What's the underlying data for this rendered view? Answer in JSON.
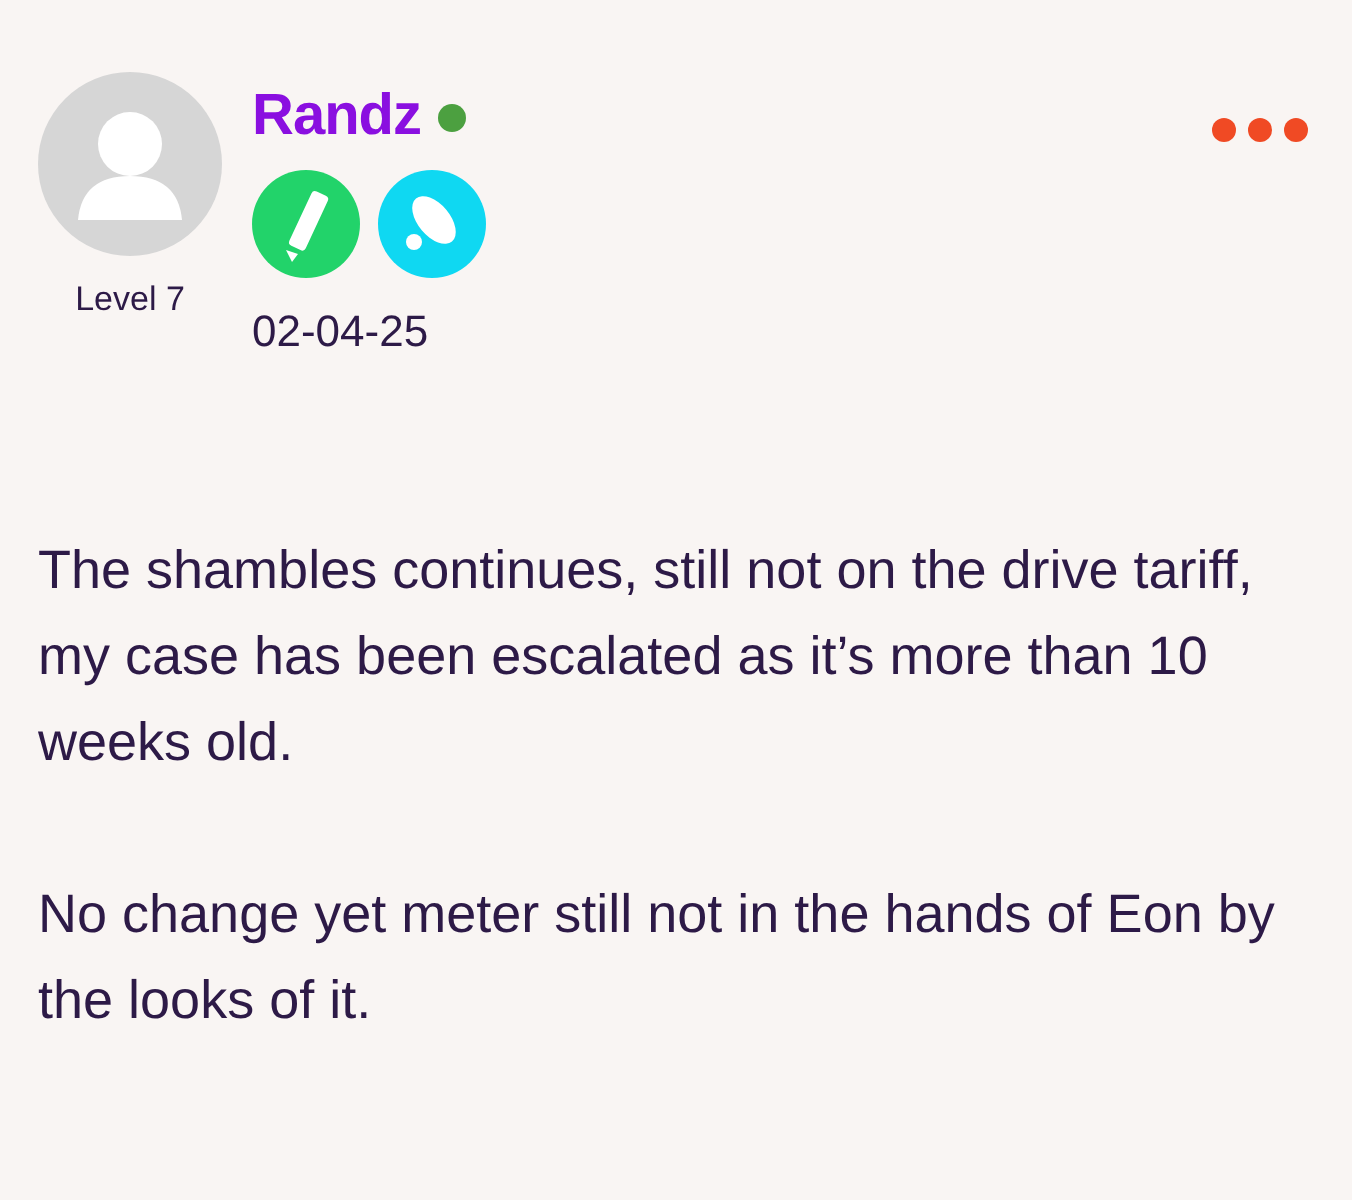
{
  "author": {
    "name": "Randz",
    "online": true,
    "level": "Level 7",
    "badges": [
      {
        "kind": "pencil",
        "color": "#22d36a"
      },
      {
        "kind": "rocket",
        "color": "#0fd8f2"
      }
    ],
    "date": "02-04-25"
  },
  "paragraphs": [
    "The shambles continues, still not on the drive tariff, my case has been escalated as it’s more than 10 weeks old.",
    "No change yet meter still not in the hands of Eon by the looks of it."
  ]
}
